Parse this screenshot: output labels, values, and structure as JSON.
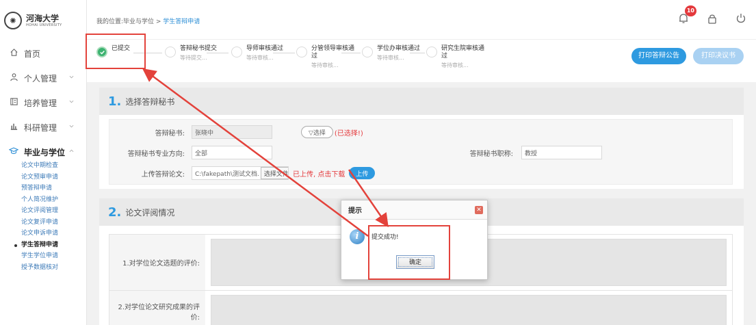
{
  "logo": {
    "name_cn": "河海大学",
    "name_en": "HOHAI UNIVERSITY"
  },
  "breadcrumb": {
    "prefix": "我的位置:毕业与学位 > ",
    "current": "学生答辩申请"
  },
  "notifications": {
    "count": "10"
  },
  "sidebar": {
    "items": [
      {
        "label": "首页",
        "icon": "home-icon"
      },
      {
        "label": "个人管理",
        "icon": "user-icon"
      },
      {
        "label": "培养管理",
        "icon": "book-icon"
      },
      {
        "label": "科研管理",
        "icon": "chart-icon"
      },
      {
        "label": "毕业与学位",
        "icon": "graduation-cap-icon"
      }
    ],
    "sub_items": [
      "论文中期检查",
      "论文预审申请",
      "预答辩申请",
      "个人简况维护",
      "论文评阅管理",
      "论文复评申请",
      "论文申诉申请",
      "学生答辩申请",
      "学生学位申请",
      "授予数据核对"
    ]
  },
  "steps": [
    {
      "title": "已提交",
      "sub": ""
    },
    {
      "title": "答辩秘书提交",
      "sub": "等待提交..."
    },
    {
      "title": "导师审核通过",
      "sub": "等待审核..."
    },
    {
      "title": "分管领导审核通过",
      "sub": "等待审核..."
    },
    {
      "title": "学位办审核通过",
      "sub": "等待审核..."
    },
    {
      "title": "研究生院审核通过",
      "sub": "等待审核..."
    }
  ],
  "actions": {
    "print_notice": "打印答辩公告",
    "print_resolution": "打印决议书"
  },
  "section1": {
    "num": "1.",
    "title": "选择答辩秘书",
    "secretary_label": "答辩秘书:",
    "secretary_value": "张晓中",
    "select_btn": "▽选择",
    "selected_text": "(已选择!)",
    "major_label": "答辩秘书专业方向:",
    "major_value": "全部",
    "title_label": "答辩秘书职称:",
    "title_value": "教授",
    "upload_label": "上传答辩论文:",
    "upload_path": "C:\\fakepath\\测试文档.",
    "choose_file": "选择文件",
    "uploaded_text": "已上传, 点击下载",
    "upload_btn": "上传"
  },
  "section2": {
    "num": "2.",
    "title": "论文评阅情况",
    "rows": [
      "1.对学位论文选题的评价:",
      "2.对学位论文研究成果的评价:"
    ]
  },
  "dialog": {
    "title": "提示",
    "message": "提交成功!",
    "ok": "确定"
  },
  "colors": {
    "accent": "#2e9ae0",
    "success": "#3cb371",
    "annotation": "#e3423b"
  }
}
